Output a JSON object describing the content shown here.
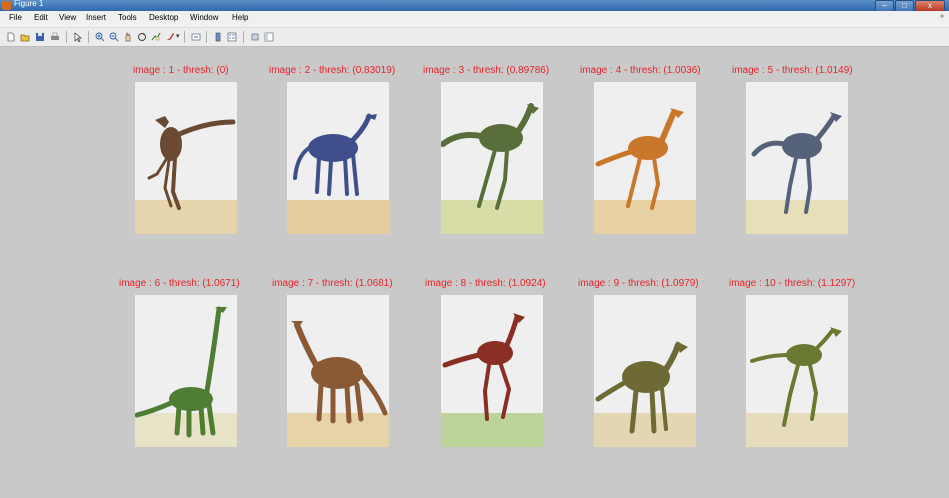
{
  "window": {
    "title": "Figure 1",
    "controls": [
      "–",
      "□",
      "x"
    ]
  },
  "menu": [
    "File",
    "Edit",
    "View",
    "Insert",
    "Tools",
    "Desktop",
    "Window",
    "Help"
  ],
  "menu_overflow": "»",
  "toolbar": [
    "new-figure-icon",
    "open-file-icon",
    "save-icon",
    "print-icon",
    "pointer-icon",
    "zoom-in-icon",
    "zoom-out-icon",
    "pan-icon",
    "rotate-icon",
    "data-cursor-icon",
    "brush-icon",
    "link-icon",
    "insert-colorbar-icon",
    "insert-legend-icon",
    "hide-plot-tools-icon",
    "show-plot-tools-icon"
  ],
  "images": [
    {
      "caption": "image : 1 - thresh: (0)",
      "color": "#6b4a34",
      "ground": "#e6d4ad"
    },
    {
      "caption": "image : 2 - thresh: (0.83019)",
      "color": "#3f4f8c",
      "ground": "#e3cd9c"
    },
    {
      "caption": "image : 3 - thresh: (0.89786)",
      "color": "#5a6e3c",
      "ground": "#d8dca6"
    },
    {
      "caption": "image : 4 - thresh: (1.0036)",
      "color": "#c9772a",
      "ground": "#e7d0a3"
    },
    {
      "caption": "image : 5 - thresh: (1.0149)",
      "color": "#55627a",
      "ground": "#e6dfb8"
    },
    {
      "caption": "image : 6 - thresh: (1.0671)",
      "color": "#4f7d33",
      "ground": "#e7e3c6"
    },
    {
      "caption": "image : 7 - thresh: (1.0681)",
      "color": "#8b5a34",
      "ground": "#e6d3a8"
    },
    {
      "caption": "image : 8 - thresh: (1.0924)",
      "color": "#8a2e24",
      "ground": "#bcd39a"
    },
    {
      "caption": "image : 9 - thresh: (1.0979)",
      "color": "#6e6a36",
      "ground": "#e2d7b2"
    },
    {
      "caption": "image : 10 - thresh: (1.1297)",
      "color": "#6a7a32",
      "ground": "#e6dcbb"
    }
  ]
}
